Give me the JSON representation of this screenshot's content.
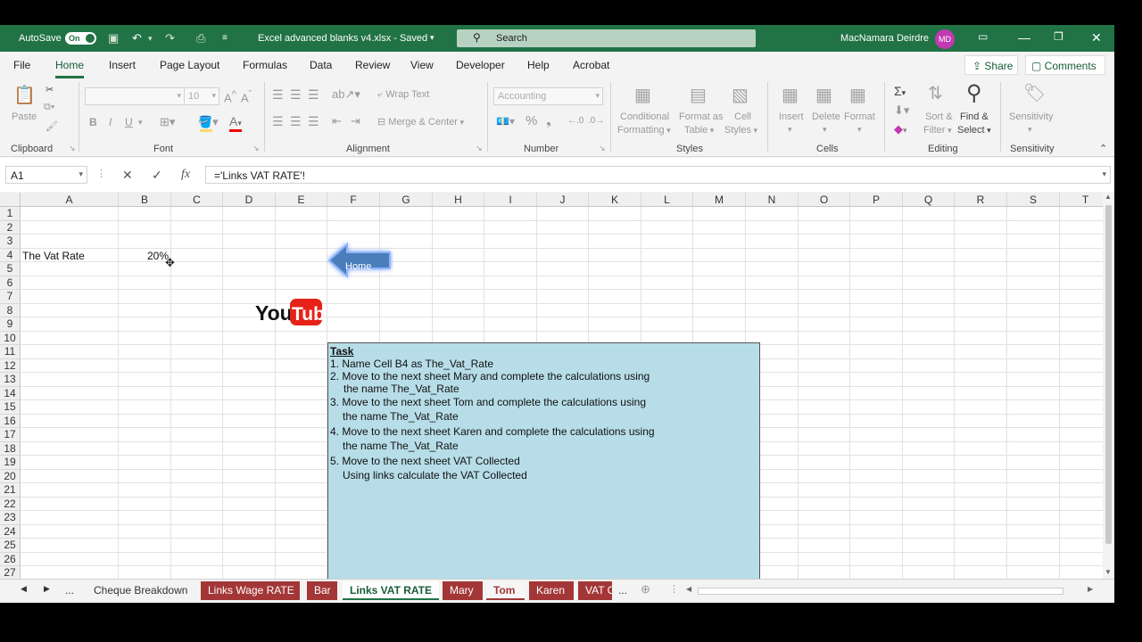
{
  "titlebar": {
    "autosave_label": "AutoSave",
    "autosave_state": "On",
    "filename": "Excel advanced blanks v4.xlsx  -  Saved",
    "search_placeholder": "Search",
    "user_name": "MacNamara Deirdre",
    "user_initials": "MD"
  },
  "menu": {
    "tabs": [
      "File",
      "Home",
      "Insert",
      "Page Layout",
      "Formulas",
      "Data",
      "Review",
      "View",
      "Developer",
      "Help",
      "Acrobat"
    ],
    "active": "Home",
    "share": "Share",
    "comments": "Comments"
  },
  "ribbon": {
    "clipboard": {
      "label": "Clipboard",
      "paste": "Paste"
    },
    "font": {
      "label": "Font",
      "size": "10",
      "bold": "B",
      "italic": "I",
      "underline": "U"
    },
    "alignment": {
      "label": "Alignment",
      "wrap": "Wrap Text",
      "merge": "Merge & Center"
    },
    "number": {
      "label": "Number",
      "format": "Accounting"
    },
    "styles": {
      "label": "Styles",
      "conditional": "Conditional",
      "conditional2": "Formatting",
      "format_table": "Format as",
      "format_table2": "Table",
      "cell_styles": "Cell",
      "cell_styles2": "Styles"
    },
    "cells": {
      "label": "Cells",
      "insert": "Insert",
      "delete": "Delete",
      "format": "Format"
    },
    "editing": {
      "label": "Editing",
      "sort": "Sort &",
      "sort2": "Filter",
      "find": "Find &",
      "find2": "Select"
    },
    "sensitivity": {
      "label": "Sensitivity",
      "button": "Sensitivity"
    }
  },
  "formula_bar": {
    "name_box": "A1",
    "formula": "='Links VAT RATE'!"
  },
  "grid": {
    "columns": [
      "A",
      "B",
      "C",
      "D",
      "E",
      "F",
      "G",
      "H",
      "I",
      "J",
      "K",
      "L",
      "M",
      "N",
      "O",
      "P",
      "Q",
      "R",
      "S",
      "T"
    ],
    "rows": [
      "1",
      "2",
      "3",
      "4",
      "5",
      "6",
      "7",
      "8",
      "9",
      "10",
      "11",
      "12",
      "13",
      "14",
      "15",
      "16",
      "17",
      "18",
      "19",
      "20",
      "21",
      "22",
      "23",
      "24",
      "25",
      "26",
      "27"
    ],
    "a4": "The Vat Rate",
    "b4": "20%"
  },
  "shapes": {
    "home_button": "Home",
    "youtube_logo": "YouTube",
    "task_title": "Task",
    "task_lines": [
      "1.  Name Cell B4 as The_Vat_Rate",
      "2.  Move to the next sheet Mary and complete the calculations using",
      "     the name The_Vat_Rate",
      "3.  Move to the next sheet Tom and complete the calculations using",
      "     the name The_Vat_Rate",
      "4.  Move to the next sheet Karen and complete the calculations using",
      "     the name The_Vat_Rate",
      "5.  Move to the next sheet VAT Collected",
      "     Using links calculate the VAT Collected"
    ]
  },
  "sheets": {
    "ellipsis": "...",
    "tabs": [
      "Cheque Breakdown",
      "Links Wage RATE",
      "Bar",
      "Links VAT RATE",
      "Mary",
      "Tom",
      "Karen",
      "VAT C"
    ],
    "active": "Links VAT RATE"
  },
  "colors": {
    "excel_green": "#217346",
    "task_fill": "#b7dde8",
    "tab_red": "#a33737",
    "home_arrow": "#4a7ebb"
  }
}
